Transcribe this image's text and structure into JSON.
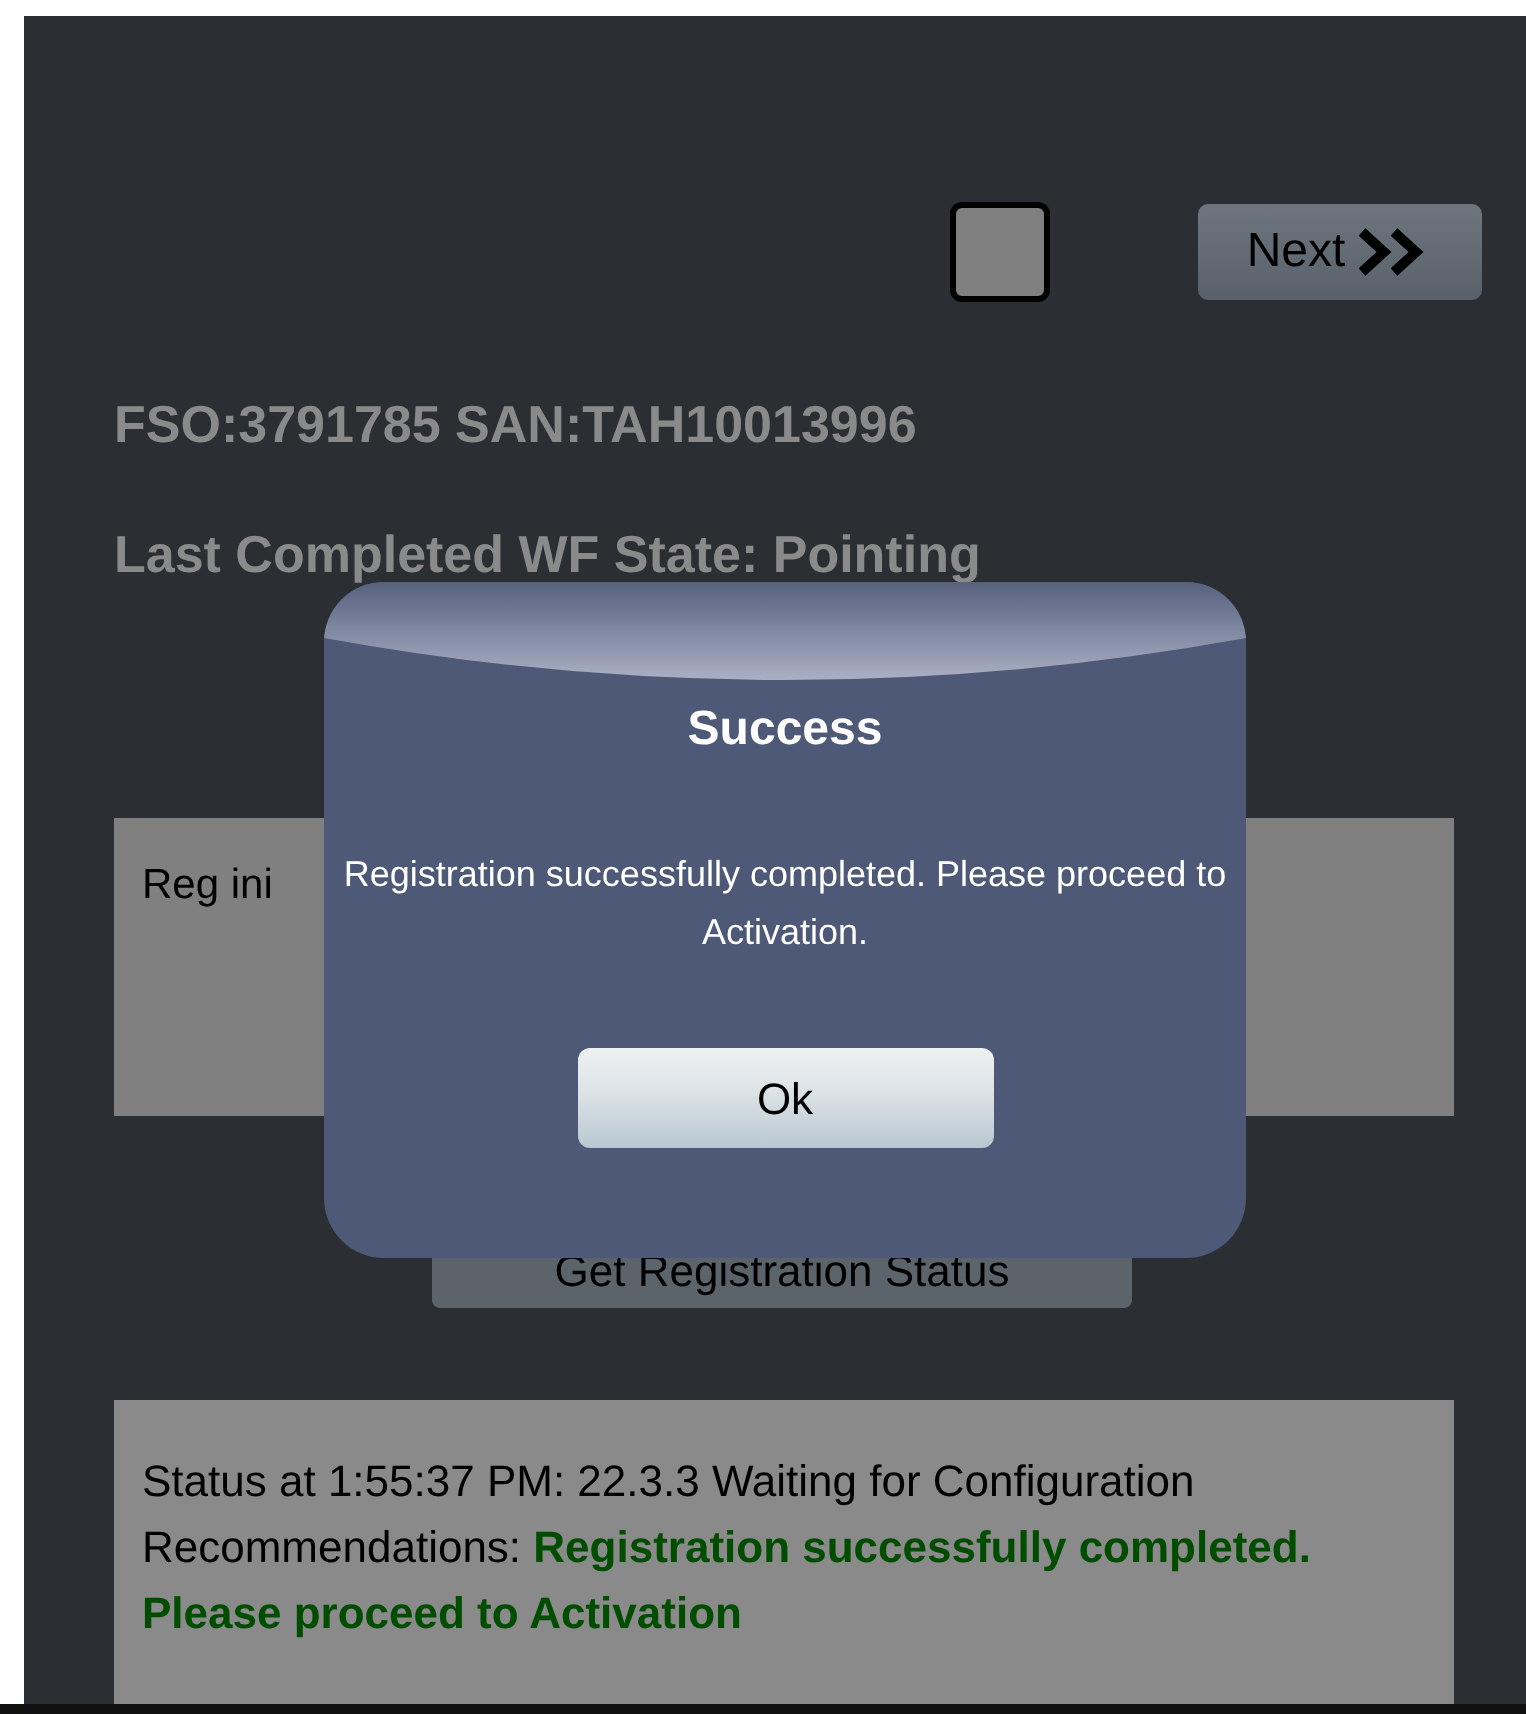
{
  "toolbar": {
    "checkbox": {
      "checked": false
    },
    "next_button": "Next"
  },
  "info": {
    "ids": "FSO:3791785 SAN:TAH10013996",
    "last_state": "Last Completed WF State: Pointing"
  },
  "registration_box": {
    "text": "Reg ini"
  },
  "status_button": "Get Registration Status",
  "status_box": {
    "line_1": "Status at 1:55:37 PM: 22.3.3 Waiting for Configuration",
    "label": "Recommendations:",
    "recommendation": "Registration successfully completed. Please proceed to Activation"
  },
  "dialog": {
    "title": "Success",
    "message": "Registration successfully completed. Please proceed to Activation.",
    "button": "Ok"
  }
}
